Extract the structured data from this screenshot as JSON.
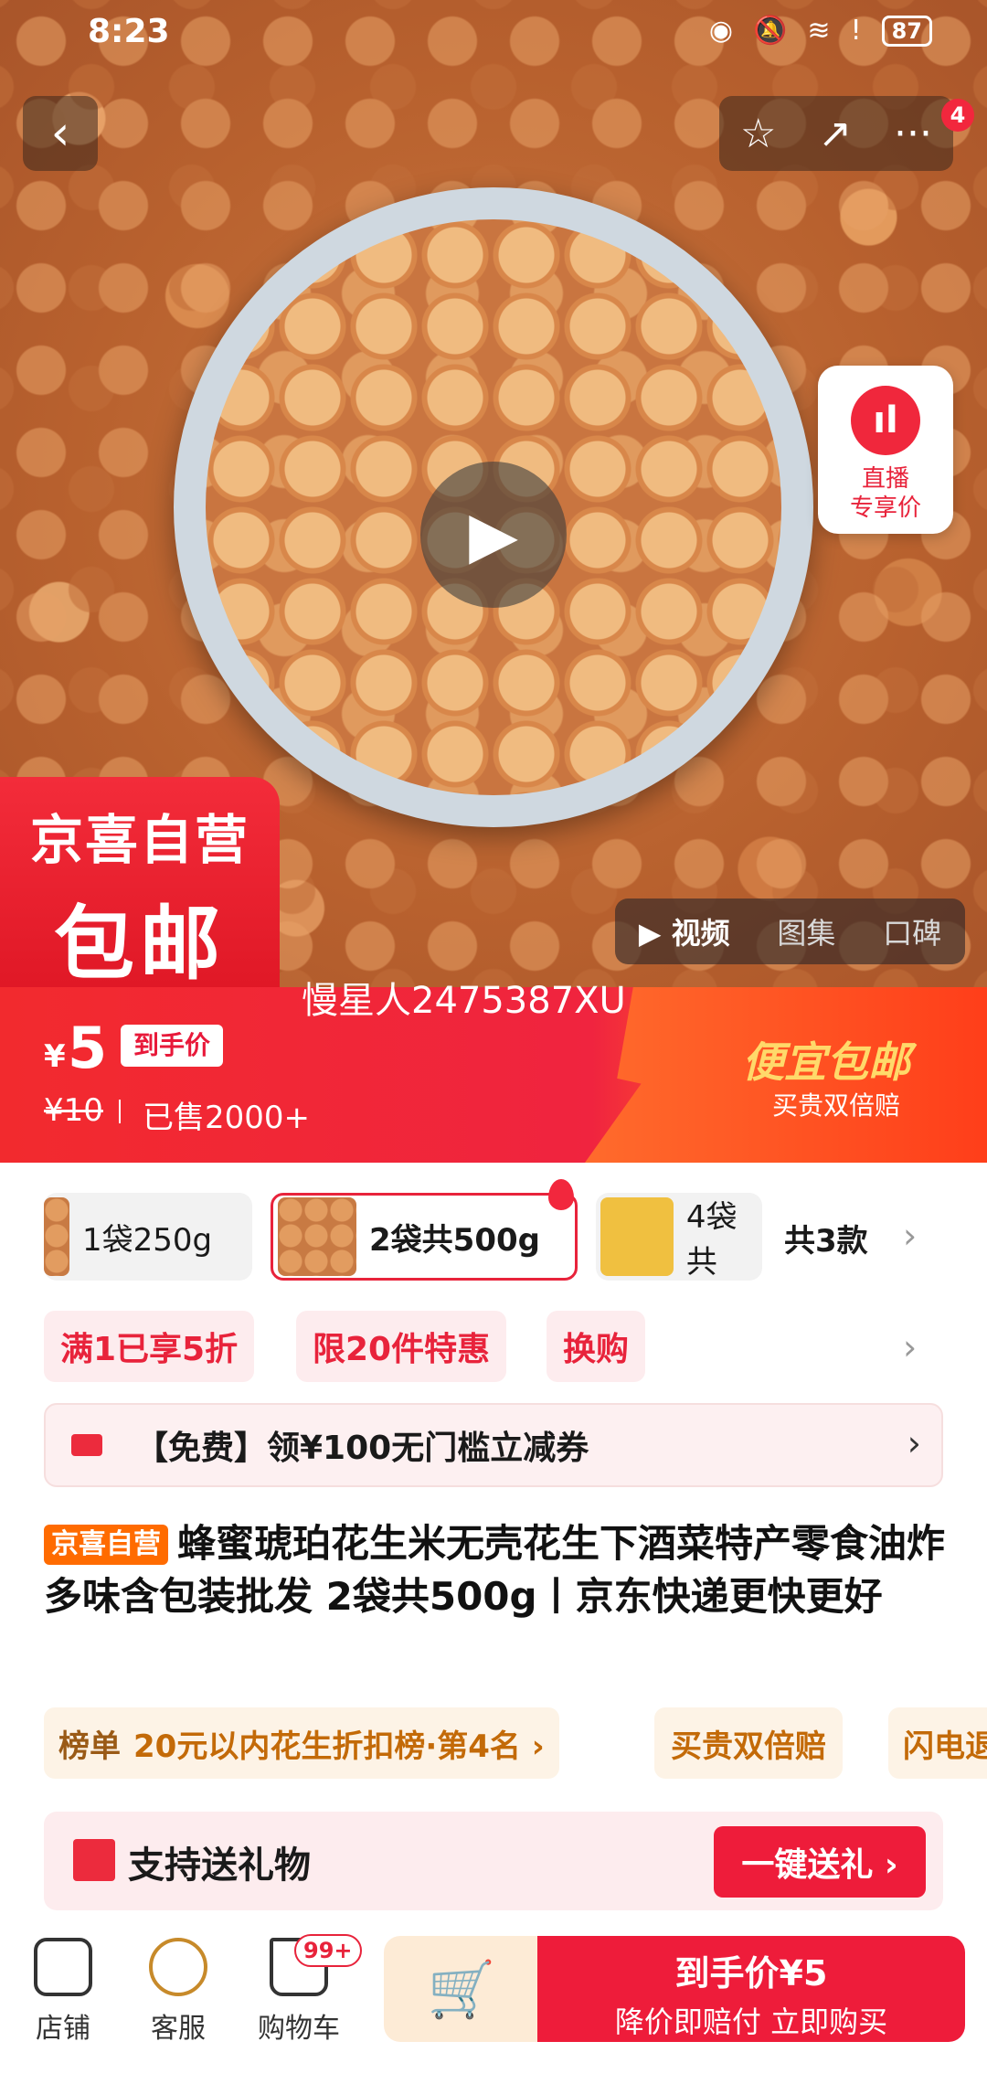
{
  "status_bar": {
    "time": "8:23",
    "battery": "87"
  },
  "top_actions": {
    "back": "‹",
    "favorite": "☆",
    "share": "↗",
    "more": "···",
    "badge_count": "4"
  },
  "live_card": {
    "line1": "直播",
    "line2": "专享价"
  },
  "promo_box": {
    "line1": "京喜自营",
    "line2": "包邮"
  },
  "media_tabs": [
    {
      "label": "▶ 视频",
      "active": true
    },
    {
      "label": "图集",
      "active": false
    },
    {
      "label": "口碑",
      "active": false
    }
  ],
  "watermark": "慢星人2475387XU",
  "price": {
    "currency": "¥",
    "value": "5",
    "tag": "到手价",
    "old_price": "¥10",
    "sold": "已售2000+"
  },
  "cheap_banner": {
    "title": "便宜包邮",
    "subtitle": "买贵双倍赔"
  },
  "variants": {
    "items": [
      {
        "label": "1袋250g",
        "selected": false
      },
      {
        "label": "2袋共500g",
        "selected": true
      },
      {
        "label": "4袋共",
        "selected": false
      }
    ],
    "count": "共3款"
  },
  "promo_tags": [
    "满1已享5折",
    "限20件特惠",
    "换购"
  ],
  "coupon": {
    "text": "【免费】领¥100无门槛立减券"
  },
  "product": {
    "badge": "京喜自营",
    "title": "蜂蜜琥珀花生米无壳花生下酒菜特产零食油炸多味含包装批发 2袋共500g丨京东快递更快更好"
  },
  "ranking": {
    "label": "榜单",
    "text": "20元以内花生折扣榜·第4名 ›"
  },
  "extra_pills": [
    "买贵双倍赔",
    "闪电退"
  ],
  "gift": {
    "text": "支持送礼物",
    "button": "一键送礼 ›"
  },
  "bottom_nav": {
    "store": "店铺",
    "service": "客服",
    "cart": "购物车",
    "cart_badge": "99+"
  },
  "buy_button": {
    "main": "到手价¥5",
    "sub": "降价即赔付 立即购买"
  },
  "colors": {
    "brand_red": "#ee1c3a",
    "orange": "#ff6b00",
    "gold": "#c78a2a"
  }
}
